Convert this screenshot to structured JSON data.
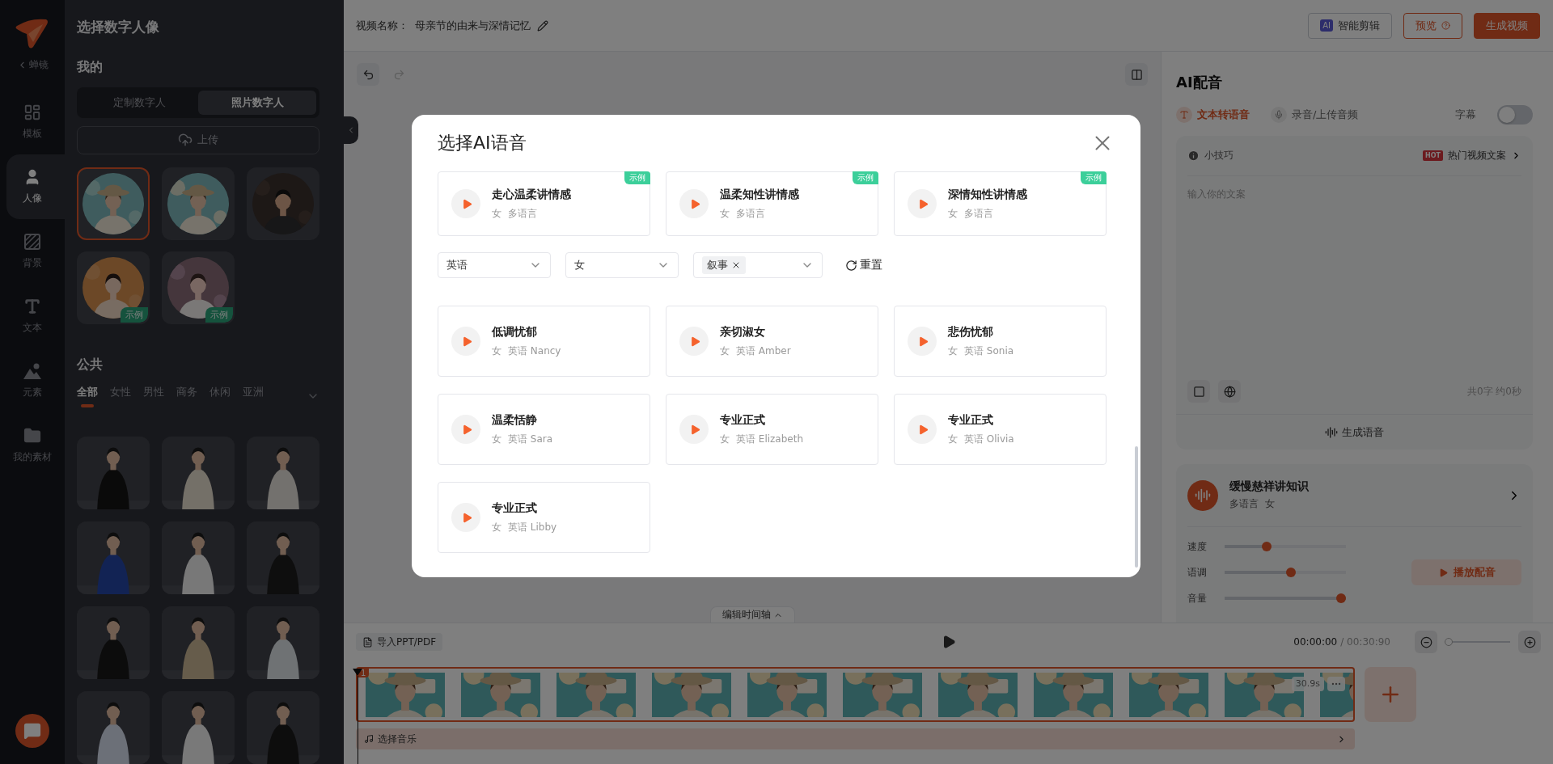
{
  "rail": {
    "back": "蝉镜",
    "items": [
      {
        "kind": "template",
        "label": "模板",
        "selected": false
      },
      {
        "kind": "portrait",
        "label": "人像",
        "selected": true
      },
      {
        "kind": "background",
        "label": "背景",
        "selected": false
      },
      {
        "kind": "text",
        "label": "文本",
        "selected": false
      },
      {
        "kind": "element",
        "label": "元素",
        "selected": false
      },
      {
        "kind": "assets",
        "label": "我的素材",
        "selected": false
      }
    ]
  },
  "left_panel": {
    "title": "选择数字人像",
    "my_title": "我的",
    "segments": [
      {
        "label": "定制数字人",
        "selected": false
      },
      {
        "label": "照片数字人",
        "selected": true
      }
    ],
    "upload": "上传",
    "avatars": [
      {
        "kind": "picture",
        "selected": true
      },
      {
        "kind": "picture",
        "selected": false
      },
      {
        "kind": "picture",
        "selected": false
      },
      {
        "kind": "picture",
        "selected": false,
        "badge": "示例"
      },
      {
        "kind": "picture",
        "selected": false,
        "badge": "示例"
      }
    ],
    "public_title": "公共",
    "categories": [
      {
        "label": "全部",
        "selected": true
      },
      {
        "label": "女性",
        "selected": false
      },
      {
        "label": "男性",
        "selected": false
      },
      {
        "label": "商务",
        "selected": false
      },
      {
        "label": "休闲",
        "selected": false
      },
      {
        "label": "亚洲",
        "selected": false
      }
    ],
    "presenters": [
      {
        "kind": "picture"
      },
      {
        "kind": "picture"
      },
      {
        "kind": "picture"
      },
      {
        "kind": "picture"
      },
      {
        "kind": "picture"
      },
      {
        "kind": "picture"
      },
      {
        "kind": "picture"
      },
      {
        "kind": "picture"
      },
      {
        "kind": "picture"
      },
      {
        "kind": "picture"
      },
      {
        "kind": "picture"
      },
      {
        "kind": "picture"
      }
    ]
  },
  "topbar": {
    "name_label": "视频名称：",
    "name": "母亲节的由来与深情记忆",
    "buttons": [
      {
        "kind": "ai",
        "label": "智能剪辑",
        "badge": "AI"
      },
      {
        "kind": "outline",
        "label": "预览"
      },
      {
        "kind": "primary",
        "label": "生成视频"
      }
    ]
  },
  "canvas": {
    "timeline_tab": "编辑时间轴"
  },
  "right_panel": {
    "title": "AI配音",
    "modes": [
      {
        "kind": "text",
        "label": "文本转语音",
        "selected": true
      },
      {
        "kind": "record",
        "label": "录音/上传音频",
        "selected": false
      }
    ],
    "subtitle_label": "字幕",
    "subtitle_on": false,
    "tips": "小技巧",
    "hot_badge": "HOT",
    "hot_link": "热门视频文案",
    "placeholder": "输入你的文案",
    "count": "共0字 约0秒",
    "generate": "生成语音",
    "voice": {
      "name": "缓慢慈祥讲知识",
      "lang": "多语言",
      "gender": "女"
    },
    "sliders": [
      {
        "label": "速度",
        "level": 0.33
      },
      {
        "label": "语调",
        "level": 0.55
      },
      {
        "label": "音量",
        "level": 1
      }
    ],
    "play": "播放配音"
  },
  "timeline": {
    "import": "导入PPT/PDF",
    "time": "00:00:00",
    "total": "/ 00:30:90",
    "zoom": {
      "level": 0.05
    },
    "clip": {
      "index": "1",
      "duration": "30.9s",
      "frames": [
        {
          "kind": "picture"
        },
        {
          "kind": "picture"
        },
        {
          "kind": "picture"
        },
        {
          "kind": "picture"
        },
        {
          "kind": "picture"
        },
        {
          "kind": "picture"
        },
        {
          "kind": "picture"
        },
        {
          "kind": "picture"
        },
        {
          "kind": "picture"
        },
        {
          "kind": "picture"
        },
        {
          "kind": "picture"
        }
      ]
    },
    "music": "选择音乐"
  },
  "dialog": {
    "title": "选择AI语音",
    "top_voices": [
      {
        "name": "走心温柔讲情感",
        "gender": "女",
        "lang": "多语言",
        "badge": "示例"
      },
      {
        "name": "温柔知性讲情感",
        "gender": "女",
        "lang": "多语言",
        "badge": "示例"
      },
      {
        "name": "深情知性讲情感",
        "gender": "女",
        "lang": "多语言",
        "badge": "示例"
      }
    ],
    "filters": [
      {
        "kind": "select",
        "value": "英语"
      },
      {
        "kind": "select",
        "value": "女"
      },
      {
        "kind": "tags",
        "tags": [
          "叙事"
        ]
      }
    ],
    "reset": "重置",
    "voices": [
      {
        "name": "低调忧郁",
        "gender": "女",
        "lang": "英语 Nancy"
      },
      {
        "name": "亲切淑女",
        "gender": "女",
        "lang": "英语 Amber"
      },
      {
        "name": "悲伤忧郁",
        "gender": "女",
        "lang": "英语 Sonia"
      },
      {
        "name": "温柔恬静",
        "gender": "女",
        "lang": "英语 Sara"
      },
      {
        "name": "专业正式",
        "gender": "女",
        "lang": "英语 Elizabeth"
      },
      {
        "name": "专业正式",
        "gender": "女",
        "lang": "英语 Olivia"
      },
      {
        "name": "专业正式",
        "gender": "女",
        "lang": "英语 Libby"
      }
    ]
  }
}
